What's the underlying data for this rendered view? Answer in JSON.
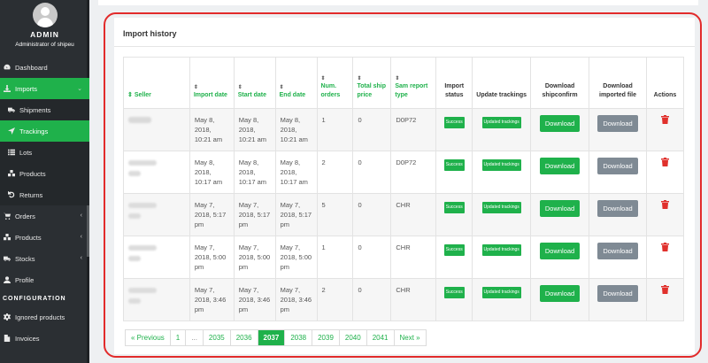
{
  "sidebar": {
    "user": {
      "name": "ADMIN",
      "role": "Administrator of shipeu"
    },
    "items": [
      {
        "label": "Dashboard",
        "icon": "dashboard-icon"
      },
      {
        "label": "Imports",
        "icon": "download-icon",
        "active": true
      },
      {
        "label": "Shipments",
        "icon": "truck-icon"
      },
      {
        "label": "Trackings",
        "icon": "location-arrow-icon",
        "active": true
      },
      {
        "label": "Lots",
        "icon": "list-icon"
      },
      {
        "label": "Products",
        "icon": "cubes-icon"
      },
      {
        "label": "Returns",
        "icon": "undo-icon"
      },
      {
        "label": "Orders",
        "icon": "cart-icon"
      },
      {
        "label": "Products",
        "icon": "cubes-icon"
      },
      {
        "label": "Stocks",
        "icon": "truck-icon"
      },
      {
        "label": "Profile",
        "icon": "user-icon"
      }
    ],
    "section_config": "CONFIGURATION",
    "config_items": [
      {
        "label": "Ignored products",
        "icon": "gear-icon"
      },
      {
        "label": "Invoices",
        "icon": "file-icon"
      }
    ]
  },
  "card": {
    "title": "Import history"
  },
  "table": {
    "headers": [
      "Seller",
      "Import date",
      "Start date",
      "End date",
      "Num. orders",
      "Total ship price",
      "Sam report type",
      "Import status",
      "Update trackings",
      "Download shipconfirm",
      "Download imported file",
      "Actions"
    ],
    "rows": [
      {
        "import_date": "May 8, 2018, 10:21 am",
        "start_date": "May 8, 2018, 10:21 am",
        "end_date": "May 8, 2018, 10:21 am",
        "num_orders": "1",
        "total_ship": "0",
        "report": "D0P72",
        "status": "Success",
        "update": "Updated trackings",
        "dl_ship": "Download",
        "dl_file": "Download"
      },
      {
        "import_date": "May 8, 2018, 10:17 am",
        "start_date": "May 8, 2018, 10:17 am",
        "end_date": "May 8, 2018, 10:17 am",
        "num_orders": "2",
        "total_ship": "0",
        "report": "D0P72",
        "status": "Success",
        "update": "Updated trackings",
        "dl_ship": "Download",
        "dl_file": "Download"
      },
      {
        "import_date": "May 7, 2018, 5:17 pm",
        "start_date": "May 7, 2018, 5:17 pm",
        "end_date": "May 7, 2018, 5:17 pm",
        "num_orders": "5",
        "total_ship": "0",
        "report": "CHR",
        "status": "Success",
        "update": "Updated trackings",
        "dl_ship": "Download",
        "dl_file": "Download"
      },
      {
        "import_date": "May 7, 2018, 5:00 pm",
        "start_date": "May 7, 2018, 5:00 pm",
        "end_date": "May 7, 2018, 5:00 pm",
        "num_orders": "1",
        "total_ship": "0",
        "report": "CHR",
        "status": "Success",
        "update": "Updated trackings",
        "dl_ship": "Download",
        "dl_file": "Download"
      },
      {
        "import_date": "May 7, 2018, 3:46 pm",
        "start_date": "May 7, 2018, 3:46 pm",
        "end_date": "May 7, 2018, 3:46 pm",
        "num_orders": "2",
        "total_ship": "0",
        "report": "CHR",
        "status": "Success",
        "update": "Updated trackings",
        "dl_ship": "Download",
        "dl_file": "Download"
      }
    ]
  },
  "pagination": {
    "pages": [
      "« Previous",
      "1",
      "...",
      "2035",
      "2036",
      "2037",
      "2038",
      "2039",
      "2040",
      "2041",
      "Next »"
    ],
    "active": "2037"
  },
  "colors": {
    "accent": "#1fb14b",
    "sidebar": "#2b2f33",
    "danger": "#e0302c",
    "highlight": "#e22b2b"
  }
}
